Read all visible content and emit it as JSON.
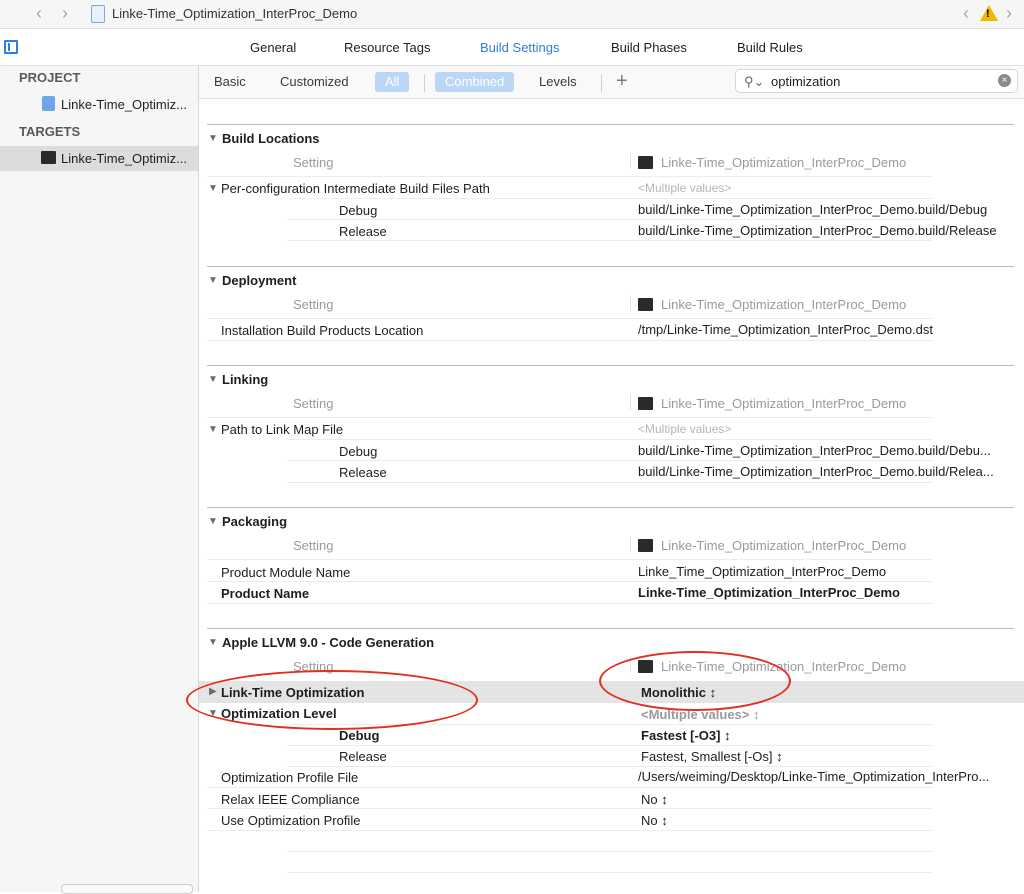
{
  "window": {
    "title": "Linke-Time_Optimization_InterProc_Demo",
    "nav_back_icon": "chevron-left",
    "nav_forward_icon": "chevron-right",
    "warning_icon": "warning-triangle"
  },
  "tabs": [
    "General",
    "Resource Tags",
    "Build Settings",
    "Build Phases",
    "Build Rules"
  ],
  "active_tab": "Build Settings",
  "sidebar": {
    "project_header": "PROJECT",
    "project_item": "Linke-Time_Optimiz...",
    "targets_header": "TARGETS",
    "target_item": "Linke-Time_Optimiz..."
  },
  "filters": {
    "basic": "Basic",
    "customized": "Customized",
    "all": "All",
    "combined": "Combined",
    "levels": "Levels",
    "add": "+"
  },
  "search": {
    "value": "optimization",
    "clear_icon": "×"
  },
  "column_header": {
    "setting": "Setting",
    "target": "Linke-Time_Optimization_InterProc_Demo"
  },
  "multiple_values": "<Multiple values>",
  "sections": {
    "build_locations": {
      "title": "Build Locations",
      "setting": "Per-configuration Intermediate Build Files Path",
      "debug_label": "Debug",
      "debug_value": "build/Linke-Time_Optimization_InterProc_Demo.build/Debug",
      "release_label": "Release",
      "release_value": "build/Linke-Time_Optimization_InterProc_Demo.build/Release"
    },
    "deployment": {
      "title": "Deployment",
      "setting": "Installation Build Products Location",
      "value": "/tmp/Linke-Time_Optimization_InterProc_Demo.dst"
    },
    "linking": {
      "title": "Linking",
      "setting": "Path to Link Map File",
      "debug_label": "Debug",
      "debug_value": "build/Linke-Time_Optimization_InterProc_Demo.build/Debu...",
      "release_label": "Release",
      "release_value": "build/Linke-Time_Optimization_InterProc_Demo.build/Relea..."
    },
    "packaging": {
      "title": "Packaging",
      "module_name_label": "Product Module Name",
      "module_name_value": "Linke_Time_Optimization_InterProc_Demo",
      "product_name_label": "Product Name",
      "product_name_value": "Linke-Time_Optimization_InterProc_Demo"
    },
    "codegen": {
      "title": "Apple LLVM 9.0 - Code Generation",
      "lto_label": "Link-Time Optimization",
      "lto_value": "Monolithic ↕",
      "opt_level_label": "Optimization Level",
      "opt_level_value": "<Multiple values> ↕",
      "debug_label": "Debug",
      "debug_value": "Fastest [-O3] ↕",
      "release_label": "Release",
      "release_value": "Fastest, Smallest [-Os] ↕",
      "profile_file_label": "Optimization Profile File",
      "profile_file_value": "/Users/weiming/Desktop/Linke-Time_Optimization_InterPro...",
      "relax_label": "Relax IEEE Compliance",
      "relax_value": "No ↕",
      "use_profile_label": "Use Optimization Profile",
      "use_profile_value": "No ↕"
    }
  },
  "annotation_color": "#e0301e",
  "accent_color": "#2f7fd8"
}
